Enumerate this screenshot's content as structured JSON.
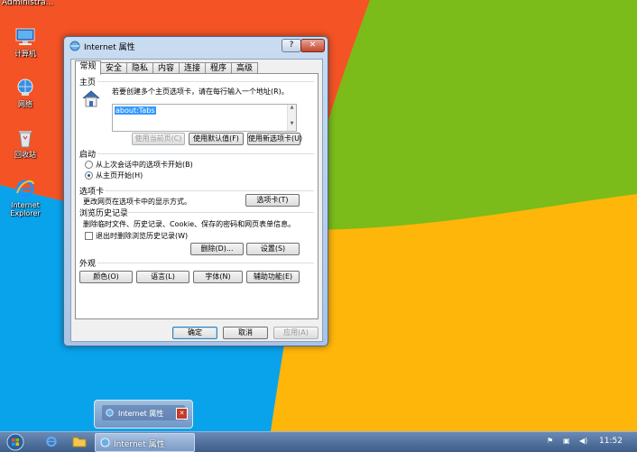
{
  "desktop": {
    "top_label": "Administra...",
    "icons": [
      {
        "label": "计算机",
        "icon": "computer-icon"
      },
      {
        "label": "网络",
        "icon": "network-icon"
      },
      {
        "label": "回收站",
        "icon": "recycle-bin-icon"
      },
      {
        "label": "Internet\nExplorer",
        "icon": "ie-icon"
      }
    ]
  },
  "dialog": {
    "title": "Internet 属性",
    "help_label": "?",
    "close_label": "✕",
    "tabs": [
      "常规",
      "安全",
      "隐私",
      "内容",
      "连接",
      "程序",
      "高级"
    ],
    "homepage": {
      "heading": "主页",
      "instruction": "若要创建多个主页选项卡，请在每行输入一个地址(R)。",
      "value": "about:Tabs",
      "btn_current": "使用当前页(C)",
      "btn_default": "使用默认值(F)",
      "btn_newtab": "使用新选项卡(U)"
    },
    "startup": {
      "heading": "启动",
      "opt_last": "从上次会话中的选项卡开始(B)",
      "opt_home": "从主页开始(H)"
    },
    "tabs_section": {
      "heading": "选项卡",
      "desc": "更改网页在选项卡中的显示方式。",
      "btn": "选项卡(T)"
    },
    "history": {
      "heading": "浏览历史记录",
      "desc": "删除临时文件、历史记录、Cookie、保存的密码和网页表单信息。",
      "checkbox": "退出时删除浏览历史记录(W)",
      "btn_delete": "删除(D)...",
      "btn_settings": "设置(S)"
    },
    "appearance": {
      "heading": "外观",
      "btn_colors": "颜色(O)",
      "btn_languages": "语言(L)",
      "btn_fonts": "字体(N)",
      "btn_accessibility": "辅助功能(E)"
    },
    "footer": {
      "ok": "确定",
      "cancel": "取消",
      "apply": "应用(A)"
    }
  },
  "taskbar": {
    "active_window": "Internet 属性",
    "preview_title": "Internet 属性",
    "clock": "11:52"
  },
  "colors": {
    "accent": "#3399ff",
    "orange": "#f35325",
    "green": "#81bc06",
    "blue": "#05a6f0",
    "yellow": "#ffba08"
  }
}
